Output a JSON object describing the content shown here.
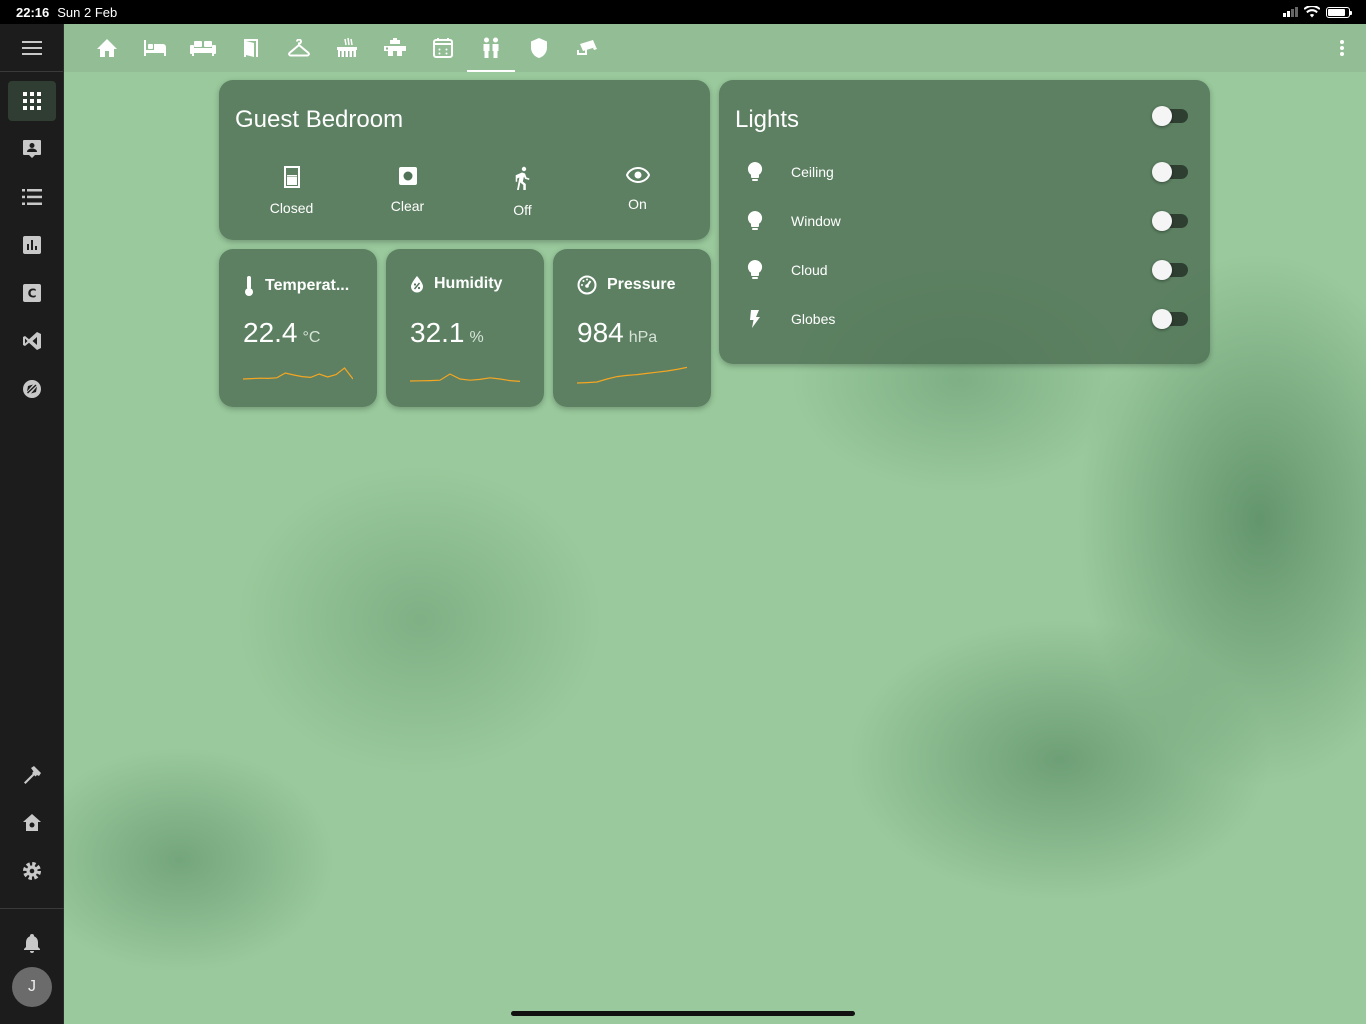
{
  "status_bar": {
    "time": "22:16",
    "date": "Sun 2 Feb",
    "battery_level": 0.85
  },
  "sidebar": {
    "items": [
      {
        "icon": "view-dashboard-icon",
        "active": true
      },
      {
        "icon": "account-box-icon"
      },
      {
        "icon": "format-list-icon"
      },
      {
        "icon": "chart-bar-icon"
      },
      {
        "icon": "letter-c-box-icon"
      },
      {
        "icon": "visual-studio-code-icon"
      },
      {
        "icon": "compass-slash-icon"
      }
    ],
    "bottom_items": [
      {
        "icon": "hammer-icon"
      },
      {
        "icon": "home-addon-icon"
      },
      {
        "icon": "gear-icon"
      }
    ],
    "notifications_icon": "bell-icon",
    "user_initial": "J"
  },
  "topbar": {
    "tabs": [
      {
        "icon": "home-icon"
      },
      {
        "icon": "bed-icon"
      },
      {
        "icon": "sofa-icon"
      },
      {
        "icon": "door-icon"
      },
      {
        "icon": "hanger-icon"
      },
      {
        "icon": "shower-icon"
      },
      {
        "icon": "pipe-icon"
      },
      {
        "icon": "stove-icon"
      },
      {
        "icon": "people-icon",
        "active": true
      },
      {
        "icon": "shield-icon"
      },
      {
        "icon": "cctv-icon"
      }
    ],
    "menu_icon": "dots-vertical-icon"
  },
  "room_card": {
    "title": "Guest Bedroom",
    "entities": [
      {
        "icon": "door-closed-icon",
        "state": "Closed"
      },
      {
        "icon": "square-circle-icon",
        "state": "Clear"
      },
      {
        "icon": "walk-icon",
        "state": "Off"
      },
      {
        "icon": "eye-icon",
        "state": "On"
      }
    ]
  },
  "sensors": [
    {
      "icon": "thermometer-icon",
      "name": "Temperat...",
      "value": "22.4",
      "unit": "°C",
      "trend": [
        0.3,
        0.32,
        0.34,
        0.33,
        0.36,
        0.6,
        0.5,
        0.42,
        0.38,
        0.55,
        0.4,
        0.52,
        0.85,
        0.3
      ]
    },
    {
      "icon": "water-percent-icon",
      "name": "Humidity",
      "value": "32.1",
      "unit": "%",
      "trend": [
        0.2,
        0.21,
        0.22,
        0.24,
        0.55,
        0.3,
        0.24,
        0.28,
        0.36,
        0.3,
        0.22,
        0.18
      ]
    },
    {
      "icon": "gauge-icon",
      "name": "Pressure",
      "value": "984",
      "unit": "hPa",
      "trend": [
        0.1,
        0.12,
        0.15,
        0.3,
        0.42,
        0.48,
        0.52,
        0.58,
        0.64,
        0.7,
        0.78,
        0.88
      ]
    }
  ],
  "accent_color": "#f5a623",
  "lights_card": {
    "title": "Lights",
    "master_on": false,
    "items": [
      {
        "icon": "lightbulb-icon",
        "name": "Ceiling",
        "on": false
      },
      {
        "icon": "lightbulb-icon",
        "name": "Window",
        "on": false
      },
      {
        "icon": "lightbulb-icon",
        "name": "Cloud",
        "on": false
      },
      {
        "icon": "flash-icon",
        "name": "Globes",
        "on": false
      }
    ]
  }
}
